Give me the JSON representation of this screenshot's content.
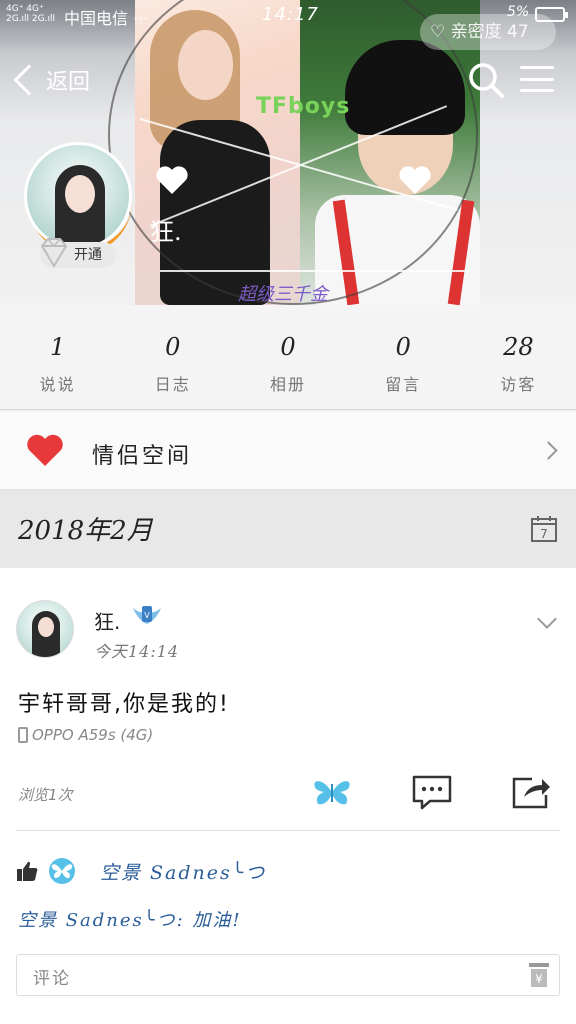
{
  "status_bar": {
    "network_1": "4G⁺ 4G⁺",
    "network_2": "2G.ıll 2G.ıll",
    "carrier": "中国电信 ···",
    "time": "14:17",
    "battery": "5%"
  },
  "header": {
    "back_label": "返回",
    "visitor_pill": "亲密度 47",
    "cover_brand": "TFboys",
    "cover_caption_1": "狂.",
    "cover_caption_2": "超级三千金",
    "vip_label": "开通"
  },
  "stats": [
    {
      "value": "1",
      "label": "说说"
    },
    {
      "value": "0",
      "label": "日志"
    },
    {
      "value": "0",
      "label": "相册"
    },
    {
      "value": "0",
      "label": "留言"
    },
    {
      "value": "28",
      "label": "访客"
    }
  ],
  "couple_space": {
    "label": "情侣空间"
  },
  "month": {
    "label": "2018年2月"
  },
  "post": {
    "author": "狂.",
    "time": "今天14:14",
    "content": "宇轩哥哥,你是我的!",
    "device": "OPPO A59s (4G)",
    "views": "浏览1次",
    "liker": "空景 Sadnes╰つ",
    "comment_author": "空景 Sadnes╰つ:",
    "comment_text": " 加油!",
    "comment_placeholder": "评论"
  },
  "colors": {
    "heart": "#e8393a",
    "butterfly": "#56c0e8",
    "link_blue": "#2a5d9a",
    "vip_orange": "#f29727"
  },
  "icons": [
    "back-chevron-icon",
    "search-icon",
    "menu-icon",
    "heart-icon",
    "calendar-icon",
    "chevron-right-icon",
    "chevron-down-icon",
    "phone-icon",
    "butterfly-icon",
    "comment-icon",
    "share-icon",
    "thumbs-up-icon",
    "gift-icon",
    "diamond-icon"
  ]
}
